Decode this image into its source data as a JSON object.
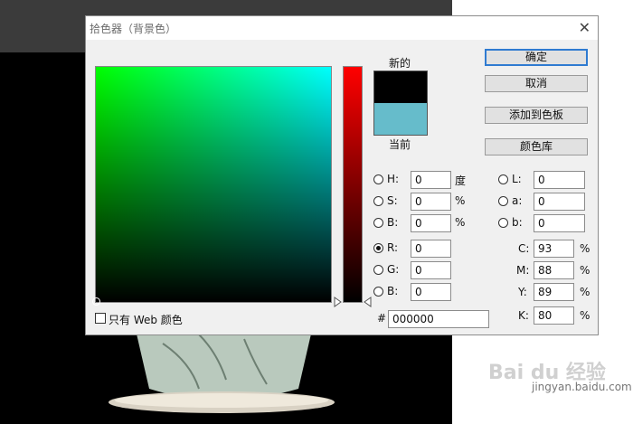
{
  "dialog": {
    "title": "拾色器（背景色）",
    "close_glyph": "✕",
    "new_label": "新的",
    "current_label": "当前",
    "colors": {
      "new": "#000000",
      "current": "#66bccb"
    },
    "buttons": {
      "ok": "确定",
      "cancel": "取消",
      "add_swatch": "添加到色板",
      "libraries": "颜色库"
    },
    "hsb": [
      {
        "key": "H:",
        "value": "0",
        "unit": "度"
      },
      {
        "key": "S:",
        "value": "0",
        "unit": "%"
      },
      {
        "key": "B:",
        "value": "0",
        "unit": "%"
      }
    ],
    "rgb": [
      {
        "key": "R:",
        "value": "0",
        "selected": true
      },
      {
        "key": "G:",
        "value": "0"
      },
      {
        "key": "B:",
        "value": "0"
      }
    ],
    "lab": [
      {
        "key": "L:",
        "value": "0"
      },
      {
        "key": "a:",
        "value": "0"
      },
      {
        "key": "b:",
        "value": "0"
      }
    ],
    "cmyk": [
      {
        "key": "C:",
        "value": "93",
        "unit": "%"
      },
      {
        "key": "M:",
        "value": "88",
        "unit": "%"
      },
      {
        "key": "Y:",
        "value": "89",
        "unit": "%"
      },
      {
        "key": "K:",
        "value": "80",
        "unit": "%"
      }
    ],
    "hex_label": "#",
    "hex_value": "000000",
    "web_only_label": "只有 Web 颜色"
  },
  "watermark": {
    "logo": "Bai du 经验",
    "url": "jingyan.baidu.com"
  }
}
